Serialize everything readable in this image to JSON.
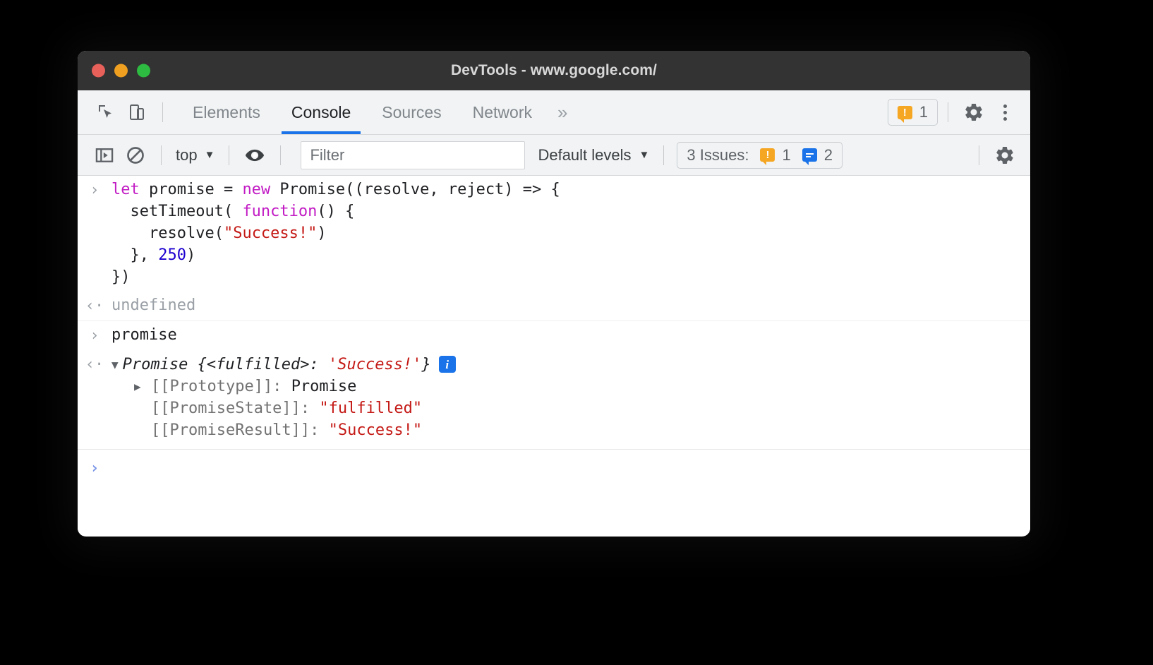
{
  "window": {
    "title": "DevTools - www.google.com/",
    "traffic_lights": [
      {
        "name": "close",
        "color": "#e8605a"
      },
      {
        "name": "minimize",
        "color": "#f0a020"
      },
      {
        "name": "maximize",
        "color": "#2dbb41"
      }
    ]
  },
  "tabstrip": {
    "inspect_icon": "inspect-element-icon",
    "device_icon": "device-toolbar-icon",
    "tabs": [
      {
        "label": "Elements",
        "active": false
      },
      {
        "label": "Console",
        "active": true
      },
      {
        "label": "Sources",
        "active": false
      },
      {
        "label": "Network",
        "active": false
      }
    ],
    "more_tabs": "»",
    "warning_chip": {
      "icon": "warning-bubble-icon",
      "count": "1"
    },
    "settings_icon": "gear-icon",
    "menu_icon": "kebab-menu-icon",
    "active_underline_color": "#1a73e8"
  },
  "console_toolbar": {
    "sidebar_icon": "console-sidebar-icon",
    "clear_icon": "clear-console-icon",
    "context": {
      "label": "top",
      "caret": "▼"
    },
    "eye_icon": "live-expression-eye-icon",
    "filter": {
      "placeholder": "Filter",
      "value": ""
    },
    "levels": {
      "label": "Default levels",
      "caret": "▼"
    },
    "issues": {
      "label": "3 Issues:",
      "warning_count": "1",
      "info_count": "2",
      "warning_color": "#f5a623",
      "info_color": "#1a73e8"
    },
    "settings_icon": "console-settings-gear-icon"
  },
  "console": {
    "entries": [
      {
        "type": "input",
        "gutter": "›",
        "lines": [
          [
            {
              "t": "let ",
              "c": "kw"
            },
            {
              "t": "promise = ",
              "c": "plain"
            },
            {
              "t": "new ",
              "c": "kw"
            },
            {
              "t": "Promise((resolve, reject) => {",
              "c": "plain"
            }
          ],
          [
            {
              "t": "  setTimeout( ",
              "c": "plain"
            },
            {
              "t": "function",
              "c": "kw"
            },
            {
              "t": "() {",
              "c": "plain"
            }
          ],
          [
            {
              "t": "    resolve(",
              "c": "plain"
            },
            {
              "t": "\"Success!\"",
              "c": "str"
            },
            {
              "t": ")",
              "c": "plain"
            }
          ],
          [
            {
              "t": "  }, ",
              "c": "plain"
            },
            {
              "t": "250",
              "c": "num"
            },
            {
              "t": ")",
              "c": "plain"
            }
          ],
          [
            {
              "t": "})",
              "c": "plain"
            }
          ]
        ]
      },
      {
        "type": "output",
        "gutter": "‹·",
        "text": "undefined",
        "style": "muted"
      },
      {
        "type": "input",
        "gutter": "›",
        "lines": [
          [
            {
              "t": "promise",
              "c": "plain"
            }
          ]
        ]
      },
      {
        "type": "object",
        "gutter": "‹·",
        "triangle": "▼",
        "summary": "Promise {<fulfilled>: ",
        "summary_value": "'Success!'",
        "summary_tail": "}",
        "badge": "i",
        "properties": [
          {
            "triangle": "▶",
            "name": "[[Prototype]]: ",
            "value": "Promise",
            "value_style": "plain"
          },
          {
            "triangle": "",
            "name": "[[PromiseState]]: ",
            "value": "\"fulfilled\"",
            "value_style": "val-str"
          },
          {
            "triangle": "",
            "name": "[[PromiseResult]]: ",
            "value": "\"Success!\"",
            "value_style": "val-str"
          }
        ]
      }
    ],
    "prompt_glyph": "›",
    "prompt_color": "#7b96e8"
  }
}
